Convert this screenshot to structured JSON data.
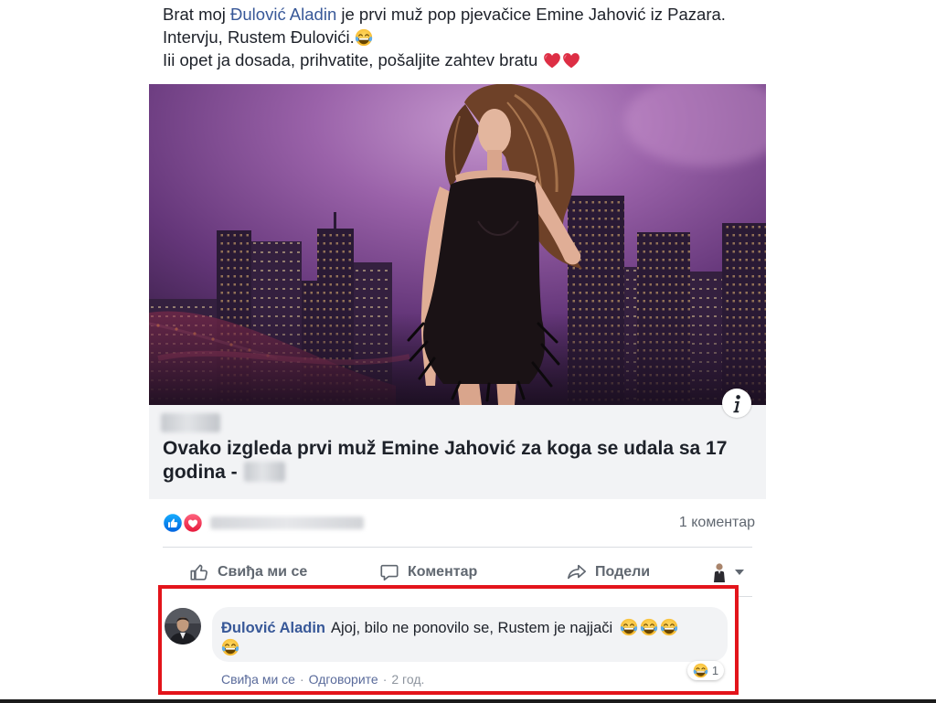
{
  "colors": {
    "text": "#1d2129",
    "link": "#385898",
    "secondary_text": "#606770",
    "preview_background": "#f2f3f5",
    "bubble_background": "#f2f3f5",
    "highlight_border": "#e3141b",
    "like_blue": "#1877f2",
    "love_red": "#f33e58"
  },
  "post": {
    "message": {
      "line1": {
        "before": "Brat moj ",
        "mention": "Đulović Aladin",
        "after": " je prvi muž pop pjevačice Emine Jahović iz Pazara."
      },
      "line2": {
        "text": "Intervju, Rustem Đulovići.",
        "emoji": "face-with-tears-of-joy"
      },
      "line3": {
        "text": "Iii opet ja dosada, prihvatite, pošaljite zahtev bratu",
        "emojis": [
          "red-heart",
          "red-heart"
        ]
      }
    },
    "link_preview": {
      "image_icon": "info-icon",
      "title": "Ovako izgleda prvi muž Emine Jahović za koga se udala sa 17 godina -"
    },
    "reactions": {
      "icons": [
        "like",
        "love"
      ],
      "comment_count": "1 коментар"
    },
    "actions": {
      "like_label": "Свиђа ми се",
      "like_icon": "thumbs-up",
      "comment_label": "Коментар",
      "comment_icon": "comment-bubble",
      "share_label": "Подели",
      "share_icon": "share-arrow",
      "audience_icon": "profile-avatar",
      "audience_caret": "chevron-down"
    }
  },
  "comment": {
    "author": "Đulović Aladin",
    "text": "Ajoj, bilo ne ponovilo se, Rustem je najjači",
    "emojis": [
      "face-with-tears-of-joy",
      "face-with-tears-of-joy",
      "face-with-tears-of-joy",
      "face-with-tears-of-joy"
    ],
    "reaction": {
      "icon": "face-with-tears-of-joy",
      "count": "1"
    },
    "footer": {
      "like_label": "Свиђа ми се",
      "separator": "·",
      "reply_label": "Одговорите",
      "age": "2 год."
    }
  }
}
